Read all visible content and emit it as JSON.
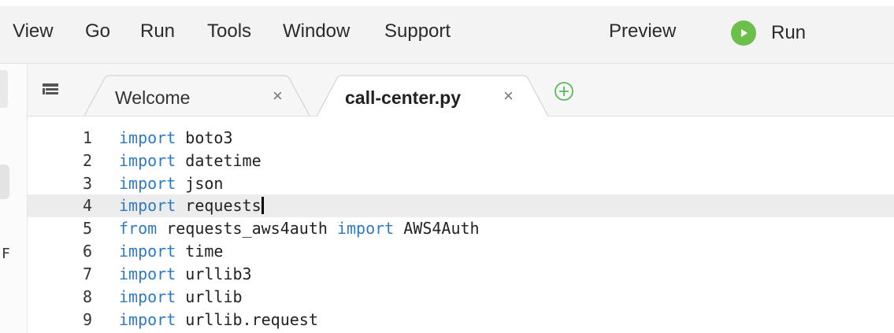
{
  "menubar": {
    "items": [
      "View",
      "Go",
      "Run",
      "Tools",
      "Window",
      "Support"
    ],
    "preview_label": "Preview",
    "run_label": "Run"
  },
  "tabs": [
    {
      "label": "Welcome",
      "active": false
    },
    {
      "label": "call-center.py",
      "active": true
    }
  ],
  "tab_close_glyph": "×",
  "left_strip_glyph": "F",
  "editor": {
    "current_line": 4,
    "lines": [
      {
        "number": "1",
        "keyword": "import",
        "rest": " boto3",
        "kw2": "",
        "rest2": ""
      },
      {
        "number": "2",
        "keyword": "import",
        "rest": " datetime",
        "kw2": "",
        "rest2": ""
      },
      {
        "number": "3",
        "keyword": "import",
        "rest": " json",
        "kw2": "",
        "rest2": ""
      },
      {
        "number": "4",
        "keyword": "import",
        "rest": " requests",
        "kw2": "",
        "rest2": ""
      },
      {
        "number": "5",
        "keyword": "from",
        "rest": " requests_aws4auth ",
        "kw2": "import",
        "rest2": " AWS4Auth"
      },
      {
        "number": "6",
        "keyword": "import",
        "rest": " time",
        "kw2": "",
        "rest2": ""
      },
      {
        "number": "7",
        "keyword": "import",
        "rest": " urllib3",
        "kw2": "",
        "rest2": ""
      },
      {
        "number": "8",
        "keyword": "import",
        "rest": " urllib",
        "kw2": "",
        "rest2": ""
      },
      {
        "number": "9",
        "keyword": "import",
        "rest": " urllib.request",
        "kw2": "",
        "rest2": ""
      }
    ]
  },
  "colors": {
    "keyword": "#2e7bc4",
    "run_green": "#6cbf4b",
    "add_tab_green": "#5cb85c"
  }
}
